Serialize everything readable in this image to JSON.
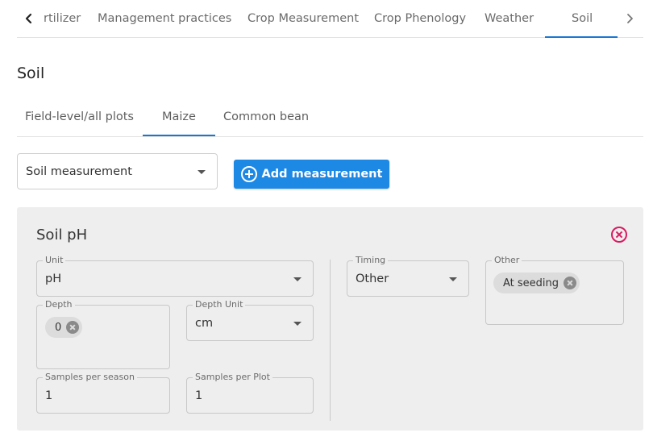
{
  "top_tabs": {
    "items": [
      {
        "label": "rtilizer"
      },
      {
        "label": "Management practices"
      },
      {
        "label": "Crop Measurement"
      },
      {
        "label": "Crop Phenology"
      },
      {
        "label": "Weather"
      },
      {
        "label": "Soil"
      }
    ],
    "active": "Soil"
  },
  "page": {
    "title": "Soil"
  },
  "crop_tabs": {
    "items": [
      {
        "label": "Field-level/all plots"
      },
      {
        "label": "Maize"
      },
      {
        "label": "Common bean"
      }
    ],
    "active": "Maize"
  },
  "toolbar": {
    "measurement_select_value": "Soil measurement",
    "add_button_label": "Add measurement"
  },
  "card": {
    "title": "Soil pH",
    "unit": {
      "label": "Unit",
      "value": "pH"
    },
    "depth": {
      "label": "Depth",
      "chip": "0"
    },
    "depth_unit": {
      "label": "Depth Unit",
      "value": "cm"
    },
    "samples_per_season": {
      "label": "Samples per season",
      "value": "1"
    },
    "samples_per_plot": {
      "label": "Samples per Plot",
      "value": "1"
    },
    "timing": {
      "label": "Timing",
      "value": "Other"
    },
    "other": {
      "label": "Other",
      "chip": "At seeding"
    }
  },
  "colors": {
    "accent": "#1976d2",
    "button": "#1e88e5",
    "danger": "#d81b60",
    "card_bg": "#eeeeee"
  }
}
